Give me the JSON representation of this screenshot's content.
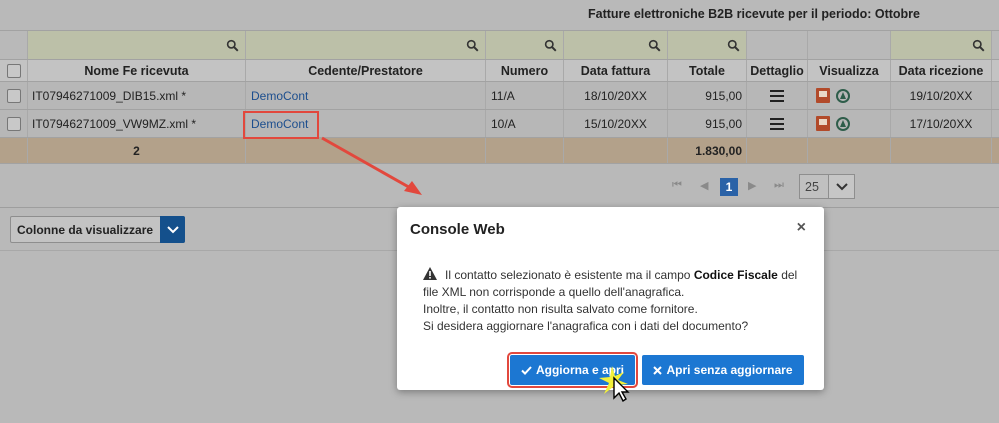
{
  "header": {
    "title": "Fatture elettroniche B2B ricevute per il periodo: Ottobre"
  },
  "columns": {
    "name": "Nome Fe ricevuta",
    "cedente": "Cedente/Prestatore",
    "numero": "Numero",
    "data_fattura": "Data fattura",
    "totale": "Totale",
    "dettaglio": "Dettaglio",
    "visualizza": "Visualizza",
    "data_ricezione": "Data ricezione"
  },
  "rows": [
    {
      "name": "IT07946271009_DIB15.xml *",
      "cedente": "DemoCont",
      "numero": "11/A",
      "data_fattura": "18/10/20XX",
      "totale": "915,00",
      "data_ricezione": "19/10/20XX"
    },
    {
      "name": "IT07946271009_VW9MZ.xml *",
      "cedente": "DemoCont",
      "numero": "10/A",
      "data_fattura": "15/10/20XX",
      "totale": "915,00",
      "data_ricezione": "17/10/20XX"
    }
  ],
  "totals": {
    "count": "2",
    "totale": "1.830,00"
  },
  "pagination": {
    "current_page": "1",
    "page_size": "25"
  },
  "column_selector": {
    "label": "Colonne da visualizzare"
  },
  "modal": {
    "title": "Console Web",
    "close": "×",
    "line1_pre": "Il contatto selezionato è esistente ma il campo ",
    "line1_bold": "Codice Fiscale",
    "line1_post": " del file XML non corrisponde a quello dell'anagrafica.",
    "line2": "Inoltre, il contatto non risulta salvato come fornitore.",
    "line3": "Si desidera aggiornare l'anagrafica con i dati del documento?",
    "btn_update": "Aggiorna e apri",
    "btn_no_update": "Apri senza aggiornare"
  },
  "colors": {
    "accent": "#1c77d2",
    "highlight": "#e2483d",
    "total_row": "#b3a18a"
  },
  "icons": [
    "search-icon",
    "menu-icon",
    "pdf-icon",
    "eco-icon",
    "warning-icon",
    "check-icon",
    "close-icon",
    "chevron-down-icon"
  ]
}
